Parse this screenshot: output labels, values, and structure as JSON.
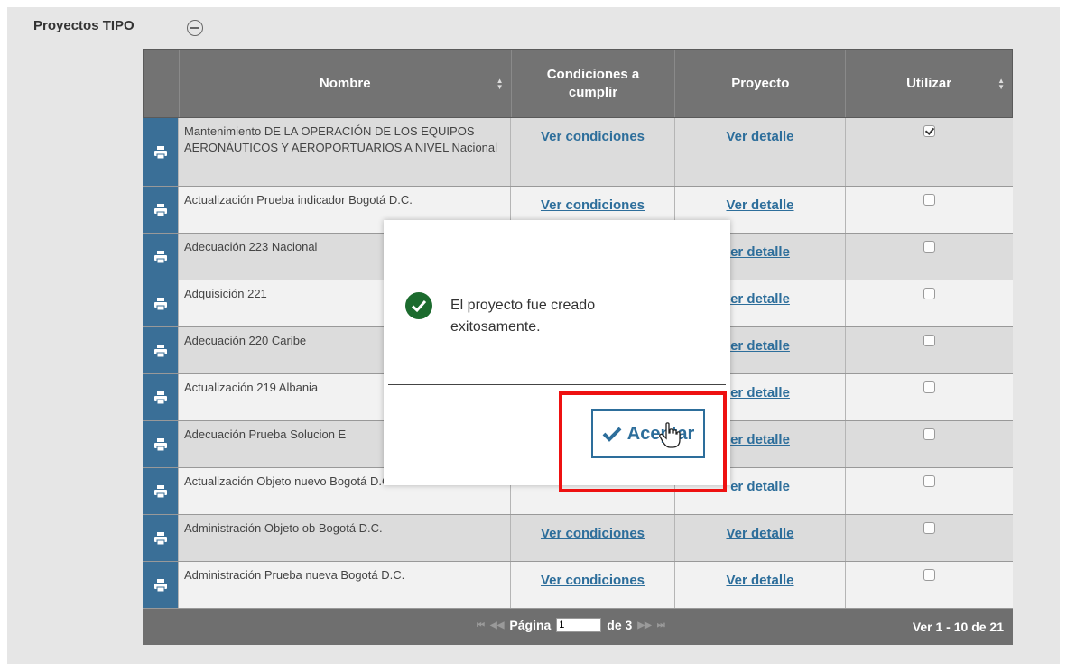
{
  "section": {
    "title": "Proyectos TIPO"
  },
  "table": {
    "columns": {
      "name": "Nombre",
      "conditions": "Condiciones a cumplir",
      "project": "Proyecto",
      "use": "Utilizar"
    },
    "rows": [
      {
        "name": "Mantenimiento DE LA  OPERACIÓN DE LOS EQUIPOS AERONÁUTICOS Y AEROPORTUARIOS A NIVEL  Nacional",
        "conditions_link": "Ver condiciones",
        "detail_link": "Ver detalle",
        "checked": true
      },
      {
        "name": "Actualización Prueba indicador  Bogotá D.C.",
        "conditions_link": "Ver condiciones",
        "detail_link": "Ver detalle",
        "checked": false
      },
      {
        "name": "Adecuación 223  Nacional",
        "conditions_link": "",
        "detail_link": "er detalle",
        "checked": false
      },
      {
        "name": "Adquisición 221",
        "conditions_link": "",
        "detail_link": "er detalle",
        "checked": false
      },
      {
        "name": "Adecuación 220  Caribe",
        "conditions_link": "",
        "detail_link": "er detalle",
        "checked": false
      },
      {
        "name": "Actualización 219  Albania",
        "conditions_link": "",
        "detail_link": "er detalle",
        "checked": false
      },
      {
        "name": "Adecuación Prueba Solucion  E",
        "conditions_link": "",
        "detail_link": "er detalle",
        "checked": false
      },
      {
        "name": "Actualización Objeto nuevo  Bogotá D.C",
        "conditions_link": "",
        "detail_link": "er detalle",
        "checked": false
      },
      {
        "name": "Administración Objeto ob  Bogotá D.C.",
        "conditions_link": "Ver condiciones",
        "detail_link": "Ver detalle",
        "checked": false
      },
      {
        "name": "Administración Prueba nueva  Bogotá D.C.",
        "conditions_link": "Ver condiciones",
        "detail_link": "Ver detalle",
        "checked": false
      }
    ],
    "pager": {
      "page_label": "Página",
      "current_page": "1",
      "of_label": "de 3",
      "range": "Ver 1 - 10 de 21"
    }
  },
  "modal": {
    "message": "El proyecto fue creado exitosamente.",
    "accept_label": "Aceptar"
  },
  "colors": {
    "header_bg": "#737373",
    "icon_column": "#3a6f97",
    "link": "#2d6e9b",
    "success": "#1c6b2e",
    "highlight": "#ee1111"
  },
  "icons": {
    "collapse": "minus-circle-icon",
    "row": "print-icon",
    "success": "check-circle-icon",
    "accept": "checkmark-icon",
    "cursor": "hand-pointer-icon"
  }
}
